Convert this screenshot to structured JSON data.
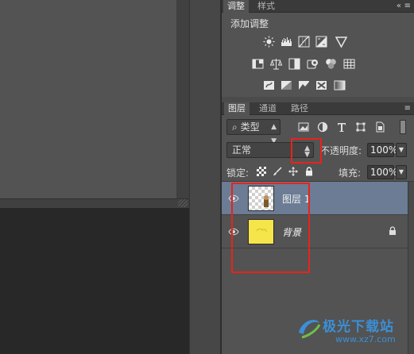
{
  "adjustments_panel": {
    "tabs": [
      "调整",
      "样式"
    ],
    "menu_glyph": "≡",
    "collapse_glyph": "«",
    "title": "添加调整"
  },
  "layers_panel": {
    "tabs": [
      "图层",
      "通道",
      "路径"
    ],
    "menu_glyph": "≡",
    "filter": {
      "search_glyph": "⌕",
      "label": "类型"
    },
    "blend_mode": "正常",
    "opacity_label": "不透明度:",
    "opacity_value": "100%",
    "lock_label": "锁定:",
    "fill_label": "填充:",
    "fill_value": "100%",
    "layers": [
      {
        "name": "图层 1",
        "selected": true,
        "thumb": "transparent-with-figure"
      },
      {
        "name": "背景",
        "selected": false,
        "thumb": "yellow",
        "locked": true
      }
    ]
  },
  "watermark": {
    "title": "极光下载站",
    "url": "www.xz7.com"
  },
  "colors": {
    "panel_bg": "#535353",
    "selected_layer": "#6b7c94",
    "highlight_red": "#e8231b",
    "background_layer_yellow": "#f5e44a",
    "watermark_blue": "#3b8fd6"
  }
}
